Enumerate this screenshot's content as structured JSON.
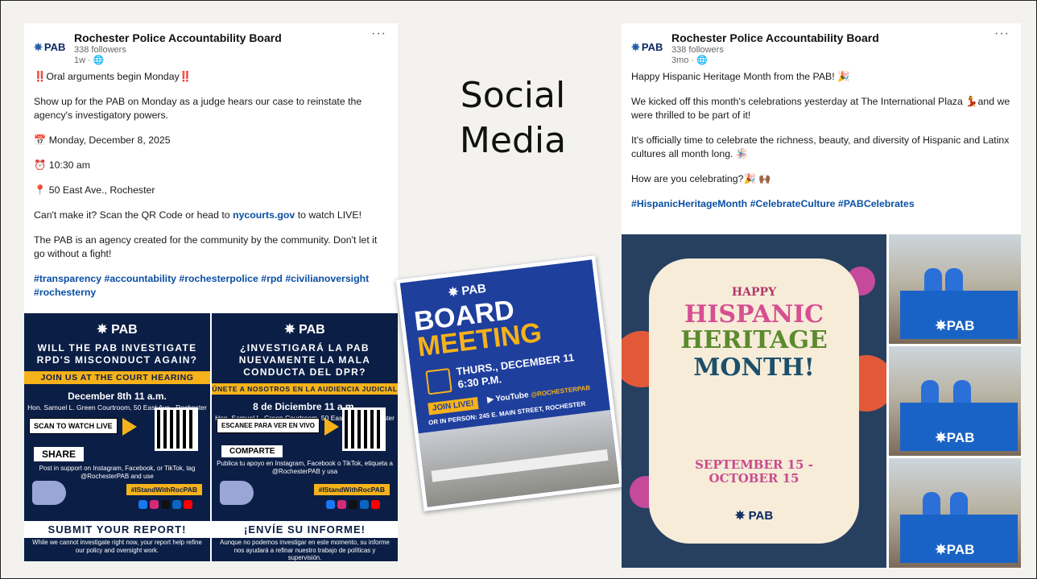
{
  "center": {
    "title_line1": "Social",
    "title_line2": "Media"
  },
  "left_post": {
    "logo": "PAB",
    "org": "Rochester Police Accountability Board",
    "followers": "338 followers",
    "age": "1w · 🌐",
    "headline_marks": "‼️",
    "headline": "Oral arguments begin Monday",
    "para1": "Show up for the PAB on Monday as a judge hears our case to reinstate the agency's investigatory powers.",
    "date_line": "📅 Monday, December 8, 2025",
    "time_line": "⏰ 10:30 am",
    "place_line": "📍 50 East Ave., Rochester",
    "cta_before": "Can't make it? Scan the QR Code or head to ",
    "cta_link": "nycourts.gov",
    "cta_after": " to watch LIVE!",
    "para2": "The PAB is an agency created for the community by the community. Don't let it go without a fight!",
    "hashtags": "#transparency #accountability #rochesterpolice #rpd #civilianoversight #rochesterny"
  },
  "flyer_en": {
    "logo": "PAB",
    "title": "WILL THE PAB INVESTIGATE RPD'S MISCONDUCT AGAIN?",
    "band": "JOIN US AT THE COURT HEARING",
    "date": "December 8th      11 a.m.",
    "room": "Hon. Samuel L. Green Courtroom, 50 East Ave., Rochester",
    "scan": "SCAN TO WATCH LIVE",
    "share": "SHARE",
    "post": "Post in support on Instagram, Facebook, or TikTok, tag @RochesterPAB and use",
    "tag": "#IStandWithRocPAB",
    "report": "SUBMIT YOUR REPORT!",
    "foot": "While we cannot investigate right now, your report help refine our policy and oversight work."
  },
  "flyer_es": {
    "logo": "PAB",
    "title": "¿INVESTIGARÁ LA PAB NUEVAMENTE LA MALA CONDUCTA DEL DPR?",
    "band": "ÚNETE A NOSOTROS EN LA AUDIENCIA JUDICIAL",
    "date": "8 de Diciembre      11 a.m.",
    "room": "Hon. Samuel L. Green Courtroom, 50 East Ave., Rochester",
    "scan": "ESCANEE PARA VER EN VIVO",
    "share": "COMPARTE",
    "post": "Publica tu apoyo en Instagram, Facebook o TikTok, etiqueta a @RochesterPAB y usa",
    "tag": "#IStandWithRocPAB",
    "report": "¡ENVÍE SU INFORME!",
    "foot": "Aunque no podemos investigar en este momento, su informe nos ayudará a refinar nuestro trabajo de políticas y supervisión."
  },
  "poster": {
    "logo": "PAB",
    "title1": "BOARD",
    "title2": "MEETING",
    "date": "THURS., DECEMBER 11",
    "time": "6:30 P.M.",
    "join": "JOIN LIVE!",
    "yt": "YouTube",
    "handle": "@ROCHESTERPAB",
    "addr": "OR IN PERSON: 245 E. MAIN STREET, ROCHESTER"
  },
  "right_post": {
    "logo": "PAB",
    "org": "Rochester Police Accountability Board",
    "followers": "338 followers",
    "age": "3mo · 🌐",
    "p1": "Happy Hispanic Heritage Month from the PAB! 🎉",
    "p2": "We kicked off this month's celebrations yesterday at The International Plaza 💃and we were thrilled to be part of it!",
    "p3": "It's officially time to celebrate the richness, beauty, and diversity of Hispanic and Latinx cultures all month long. 🪅",
    "p4": "How are you celebrating?🎉 🙌🏾",
    "hashtags": "#HispanicHeritageMonth #CelebrateCulture #PABCelebrates"
  },
  "hhm_image": {
    "happy": "HAPPY",
    "line1": "HISPANIC",
    "line2": "HERITAGE",
    "line3": "MONTH!",
    "dates1": "SEPTEMBER 15 -",
    "dates2": "OCTOBER 15",
    "logo": "PAB"
  },
  "photo_logo": "PAB"
}
